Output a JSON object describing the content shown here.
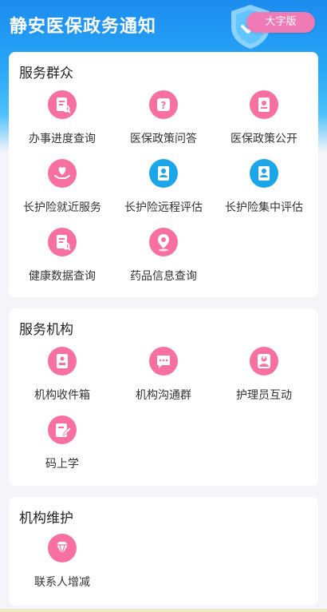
{
  "header": {
    "title": "静安医保政务通知",
    "big_font_label": "大字版"
  },
  "colors": {
    "header_blue": "#1c8cf0",
    "accent_pink": "#f07ab4",
    "icon_pink": "#f7709f",
    "icon_blue": "#1aa6e8"
  },
  "sections": [
    {
      "title": "服务群众",
      "items": [
        {
          "label": "办事进度查询",
          "icon": "document-search-icon"
        },
        {
          "label": "医保政策问答",
          "icon": "question-icon"
        },
        {
          "label": "医保政策公开",
          "icon": "document-badge-icon"
        },
        {
          "label": "长护险就近服务",
          "icon": "heart-hand-icon"
        },
        {
          "label": "长护险远程评估",
          "icon": "person-card-icon"
        },
        {
          "label": "长护险集中评估",
          "icon": "person-card-icon"
        },
        {
          "label": "健康数据查询",
          "icon": "document-search-icon"
        },
        {
          "label": "药品信息查询",
          "icon": "location-pin-icon"
        }
      ]
    },
    {
      "title": "服务机构",
      "items": [
        {
          "label": "机构收件箱",
          "icon": "inbox-icon"
        },
        {
          "label": "机构沟通群",
          "icon": "chat-icon"
        },
        {
          "label": "护理员互动",
          "icon": "nurse-icon"
        },
        {
          "label": "码上学",
          "icon": "book-pen-icon"
        }
      ]
    },
    {
      "title": "机构维护",
      "items": [
        {
          "label": "联系人增减",
          "icon": "diamond-icon"
        }
      ]
    }
  ]
}
